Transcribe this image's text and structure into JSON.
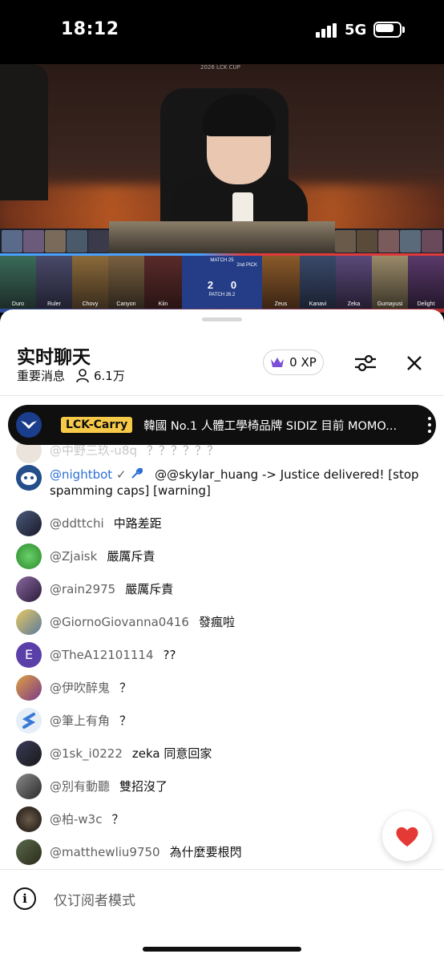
{
  "status_bar": {
    "time": "18:12",
    "network": "5G"
  },
  "video": {
    "cup_label": "2026 LCK CUP",
    "players": [
      "Duro",
      "Ruler",
      "Chovy",
      "Canyon",
      "Kiin",
      "Zeus",
      "Kanavi",
      "Zeka",
      "Gumayusi",
      "Delight"
    ],
    "match_label": "MATCH 25",
    "pick_label": "2nd PICK",
    "score_left": "2",
    "score_right": "0",
    "patch": "PATCH 26.2"
  },
  "chat": {
    "title": "实时聊天",
    "subtitle": "重要消息",
    "viewers": "6.1万",
    "xp": "0 XP",
    "pinned": {
      "author": "LCK-Carry",
      "text": "韓國 No.1 人體工學椅品牌 SIDIZ 目前 MOMO..."
    },
    "messages": [
      {
        "author": "@中野三玖-u8q",
        "text": "？？？？？？"
      },
      {
        "author": "@nightbot",
        "badges": "✓",
        "text": "@@skylar_huang -> Justice delivered! [stop spamming caps] [warning]"
      },
      {
        "author": "@ddttchi",
        "text": "中路差距"
      },
      {
        "author": "@Zjaisk",
        "text": "嚴厲斥責"
      },
      {
        "author": "@rain2975",
        "text": "嚴厲斥責"
      },
      {
        "author": "@GiornoGiovanna0416",
        "text": "發瘋啦"
      },
      {
        "author": "@TheA12101114",
        "text": "??",
        "avatar_letter": "E"
      },
      {
        "author": "@伊吹醉鬼",
        "text": "？"
      },
      {
        "author": "@筆上有角",
        "text": "？"
      },
      {
        "author": "@1sk_i0222",
        "text": "zeka 同意回家"
      },
      {
        "author": "@別有動聽",
        "text": "雙招沒了"
      },
      {
        "author": "@柏-w3c",
        "text": "？"
      },
      {
        "author": "@matthewliu9750",
        "text": "為什麼要根閃"
      }
    ],
    "readonly_label": "仅订阅者模式"
  },
  "colors": {
    "accent_yellow": "#f7c948",
    "heart": "#e53935",
    "crown": "#7b4fd6",
    "nightbot_blue": "#2c6fd6"
  }
}
